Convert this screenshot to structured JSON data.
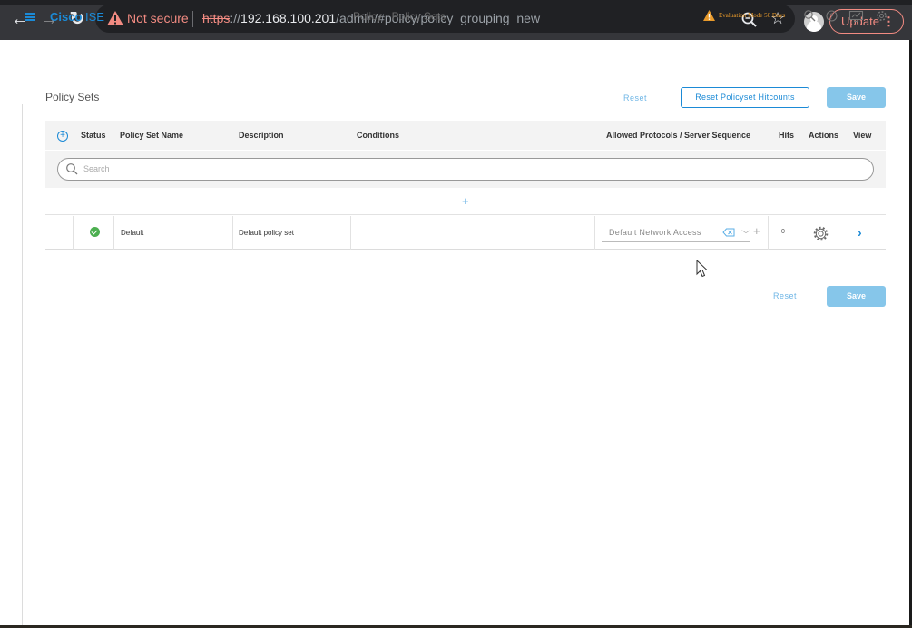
{
  "browser": {
    "security_label": "Not secure",
    "url_scheme": "https",
    "url_sep": "://",
    "url_host": "192.168.100.201",
    "url_path": "/admin/#policy/policy_grouping_new",
    "update_label": "Update",
    "update_menu": "⋮"
  },
  "header": {
    "brand_strong": "Cisco",
    "brand_rest": " ISE",
    "title": "Policy · Policy Sets",
    "eval_text": "Evaluation Mode 50 Days"
  },
  "page": {
    "title": "Policy Sets",
    "reset_label": "Reset",
    "reset_hitcounts_label": "Reset Policyset Hitcounts",
    "save_label": "Save"
  },
  "table": {
    "columns": {
      "status": "Status",
      "name": "Policy Set Name",
      "description": "Description",
      "conditions": "Conditions",
      "protocols": "Allowed Protocols / Server Sequence",
      "hits": "Hits",
      "actions": "Actions",
      "view": "View"
    },
    "search_placeholder": "Search",
    "add_label": "+",
    "rows": [
      {
        "name": "Default",
        "description": "Default policy set",
        "protocols": "Default Network Access",
        "hits": "0"
      }
    ]
  },
  "footer": {
    "reset_label": "Reset",
    "save_label": "Save"
  },
  "colors": {
    "accent": "#1b8ad6",
    "save": "#86c6ea",
    "status_ok": "#4caf50",
    "eval_warning": "#e89a2b"
  }
}
